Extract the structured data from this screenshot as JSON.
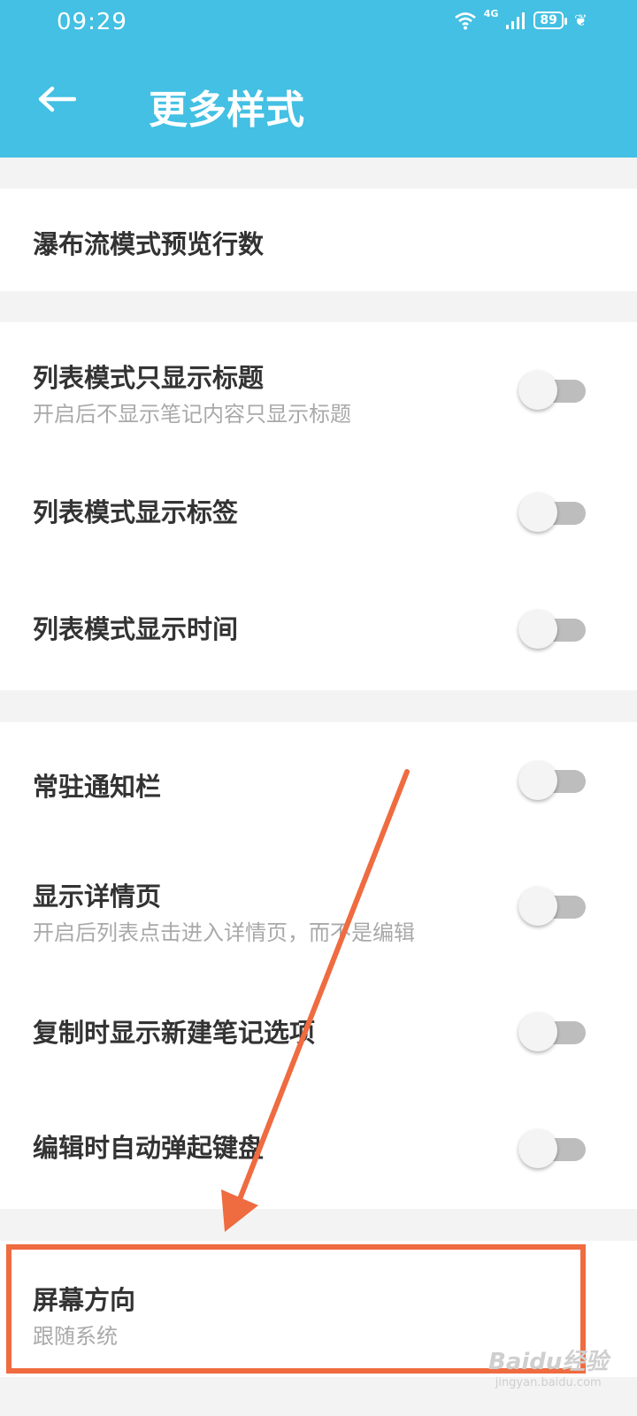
{
  "status_bar": {
    "time": "09:29",
    "network": "4G",
    "battery": "89",
    "icons": [
      "wifi-icon",
      "signal-icon",
      "battery-icon",
      "leaf-icon"
    ]
  },
  "header": {
    "title": "更多样式",
    "back_icon": "back-arrow-icon"
  },
  "sections": [
    {
      "items": [
        {
          "title": "瀑布流模式预览行数"
        }
      ]
    },
    {
      "items": [
        {
          "title": "列表模式只显示标题",
          "subtitle": "开启后不显示笔记内容只显示标题",
          "toggle": false
        },
        {
          "title": "列表模式显示标签",
          "toggle": false
        },
        {
          "title": "列表模式显示时间",
          "toggle": false
        }
      ]
    },
    {
      "items": [
        {
          "title": "常驻通知栏",
          "toggle": false
        },
        {
          "title": "显示详情页",
          "subtitle": "开启后列表点击进入详情页，而不是编辑",
          "toggle": false
        },
        {
          "title": "复制时显示新建笔记选项",
          "toggle": false
        },
        {
          "title": "编辑时自动弹起键盘",
          "toggle": false
        }
      ]
    },
    {
      "items": [
        {
          "title": "屏幕方向",
          "subtitle": "跟随系统"
        }
      ]
    }
  ],
  "annotation": {
    "color": "#ef6b40"
  },
  "watermark": {
    "main": "Baidu经验",
    "sub": "jingyan.baidu.com"
  },
  "colors": {
    "app_bar": "#43c0e3",
    "background": "#f3f3f3",
    "switch_off_track": "#bdbdbd"
  }
}
